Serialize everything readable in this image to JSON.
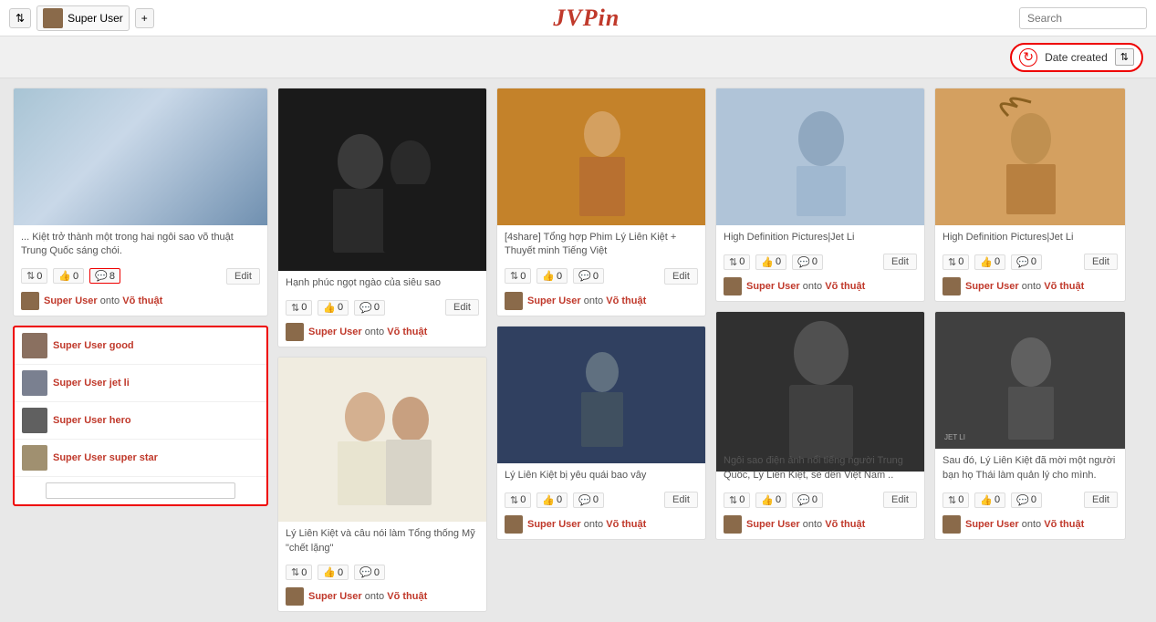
{
  "header": {
    "logo": "JVPin",
    "user_label": "Super User",
    "add_button": "+",
    "sort_button": "⇅",
    "search_placeholder": "Search"
  },
  "toolbar": {
    "refresh_icon": "↻",
    "sort_label": "Date created",
    "filter_icon": "⇅"
  },
  "pins": [
    {
      "id": "pin1",
      "image_class": "jet-li-1",
      "desc": "... Kiệt trở thành một trong hai ngôi sao võ thuật Trung Quốc sáng chói.",
      "repins": "0",
      "likes": "0",
      "comments": "8",
      "username": "Super User",
      "preposition": "onto",
      "board": "Võ thuật",
      "has_edit": true
    },
    {
      "id": "pin2",
      "image_class": "couple-1",
      "desc": "Hạnh phúc ngọt ngào của siêu sao",
      "repins": "0",
      "likes": "0",
      "comments": "0",
      "username": "Super User",
      "preposition": "onto",
      "board": "Võ thuật",
      "has_edit": true
    },
    {
      "id": "pin3",
      "image_class": "monk-1",
      "desc": "[4share] Tổng hợp Phim Lý Liên Kiệt + Thuyết minh Tiếng Việt",
      "repins": "0",
      "likes": "0",
      "comments": "0",
      "username": "Super User",
      "preposition": "onto",
      "board": "Võ thuật",
      "has_edit": true
    },
    {
      "id": "pin4",
      "image_class": "hd-jet-li",
      "desc": "High Definition Pictures|Jet Li",
      "repins": "0",
      "likes": "0",
      "comments": "0",
      "username": "Super User",
      "preposition": "onto",
      "board": "Võ thuật",
      "has_edit": true
    },
    {
      "id": "pin5",
      "image_class": "painting-1",
      "desc": "High Definition Pictures|Jet Li",
      "repins": "0",
      "likes": "0",
      "comments": "0",
      "username": "Super User",
      "preposition": "onto",
      "board": "Võ thuật",
      "has_edit": true
    },
    {
      "id": "pin6",
      "image_class": "couple-2",
      "desc": "Lý Liên Kiệt và câu nói làm Tổng thống Mỹ \"chết lặng\"",
      "repins": "0",
      "likes": "0",
      "comments": "0",
      "username": "Super User",
      "preposition": "onto",
      "board": "Võ thuật",
      "has_edit": false
    },
    {
      "id": "pin7",
      "image_class": "fighting-1",
      "desc": "Lý Liên Kiệt bị yêu quái bao vây",
      "repins": "0",
      "likes": "0",
      "comments": "0",
      "username": "Super User",
      "preposition": "onto",
      "board": "Võ thuật",
      "has_edit": true
    },
    {
      "id": "pin8",
      "image_class": "portrait-1",
      "desc": "Ngôi sao điện ảnh nổi tiếng người Trung Quốc, Lý Liên Kiệt, sẽ đến Việt Nam ..",
      "repins": "0",
      "likes": "0",
      "comments": "0",
      "username": "Super User",
      "preposition": "onto",
      "board": "Võ thuật",
      "has_edit": true
    },
    {
      "id": "pin9",
      "image_class": "painting-2",
      "desc": "Sau đó, Lý Liên Kiệt đã mời một người bạn họ Thái làm quản lý cho mình.",
      "repins": "0",
      "likes": "0",
      "comments": "0",
      "username": "Super User",
      "preposition": "onto",
      "board": "Võ thuật",
      "has_edit": true
    }
  ],
  "boards": [
    {
      "id": "board1",
      "user": "Super User",
      "name": "good"
    },
    {
      "id": "board2",
      "user": "Super User",
      "name": "jet li"
    },
    {
      "id": "board3",
      "user": "Super User",
      "name": "hero"
    },
    {
      "id": "board4",
      "user": "Super User",
      "name": "super star"
    }
  ],
  "edit_label": "Edit"
}
